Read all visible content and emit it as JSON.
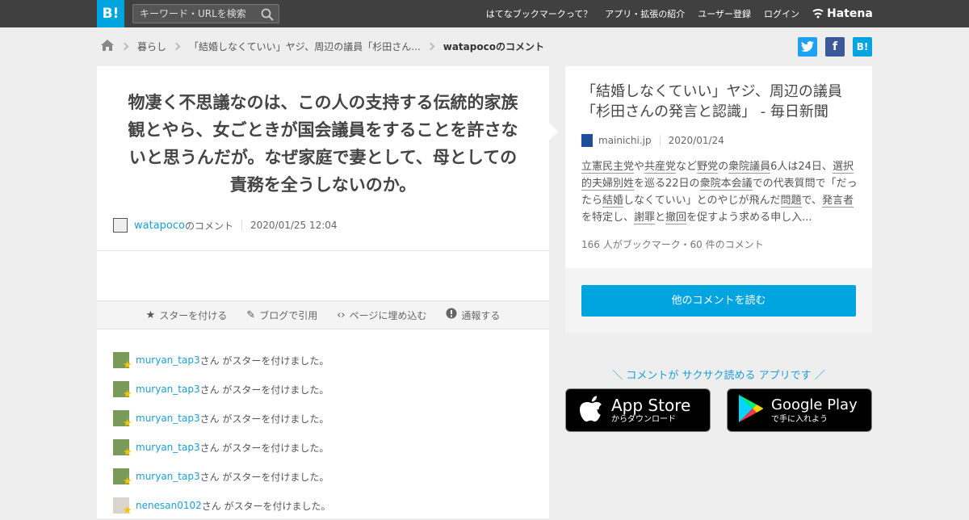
{
  "topbar": {
    "logo": "B!",
    "search_placeholder": "キーワード・URLを検索",
    "nav": [
      "はてなブックマークって？",
      "アプリ・拡張の紹介",
      "ユーザー登録",
      "ログイン"
    ],
    "hatena": "Hatena"
  },
  "breadcrumb": {
    "category": "暮らし",
    "article": "「結婚しなくていい」ヤジ、周辺の議員「杉田さん...",
    "current": "watapocoのコメント"
  },
  "share": {
    "twitter": "t",
    "facebook": "f",
    "hatebu": "B!"
  },
  "comment": {
    "text": "物凄く不思議なのは、この人の支持する伝統的家族観とやら、女ごときが国会議員をすることを許さないと思うんだが。なぜ家庭で妻として、母としての責務を全うしないのか。",
    "user": "watapoco",
    "suffix": "のコメント",
    "date": "2020/01/25 12:04"
  },
  "actions": {
    "star": "スターを付ける",
    "blog": "ブログで引用",
    "embed": "ページに埋め込む",
    "report": "通報する"
  },
  "stars": [
    {
      "user": "muryan_tap3",
      "text": "さん がスターを付けました。"
    },
    {
      "user": "muryan_tap3",
      "text": "さん がスターを付けました。"
    },
    {
      "user": "muryan_tap3",
      "text": "さん がスターを付けました。"
    },
    {
      "user": "muryan_tap3",
      "text": "さん がスターを付けました。"
    },
    {
      "user": "muryan_tap3",
      "text": "さん がスターを付けました。"
    },
    {
      "user": "nenesan0102",
      "text": "さん がスターを付けました。"
    }
  ],
  "entry": {
    "title": "「結婚しなくていい」ヤジ、周辺の議員「杉田さんの発言と認識」 - 毎日新聞",
    "domain": "mainichi.jp",
    "date": "2020/01/24",
    "desc": [
      {
        "t": "立憲民主党",
        "u": true
      },
      {
        "t": "や",
        "u": false
      },
      {
        "t": "共産党",
        "u": true
      },
      {
        "t": "など",
        "u": false
      },
      {
        "t": "野党",
        "u": true
      },
      {
        "t": "の",
        "u": false
      },
      {
        "t": "衆院議員",
        "u": true
      },
      {
        "t": "6人は24日、",
        "u": false
      },
      {
        "t": "選択的夫婦別姓",
        "u": true
      },
      {
        "t": "を巡る22日の",
        "u": false
      },
      {
        "t": "衆院本会議",
        "u": true
      },
      {
        "t": "での代表質問で「だったら",
        "u": false
      },
      {
        "t": "結婚",
        "u": true
      },
      {
        "t": "しなくていい」とのやじが飛んだ",
        "u": false
      },
      {
        "t": "問題",
        "u": true
      },
      {
        "t": "で、",
        "u": false
      },
      {
        "t": "発言者",
        "u": true
      },
      {
        "t": "を特定し、",
        "u": false
      },
      {
        "t": "謝罪",
        "u": true
      },
      {
        "t": "と",
        "u": false
      },
      {
        "t": "撤回",
        "u": true
      },
      {
        "t": "を促すよう求める申し入...",
        "u": false
      }
    ],
    "count": "166 人がブックマーク・60 件のコメント",
    "button": "他のコメントを読む"
  },
  "promo": {
    "tagline": "＼ コメントが サクサク読める アプリです ／",
    "appstore_big": "App Store",
    "appstore_small": "からダウンロード",
    "gplay_big": "Google Play",
    "gplay_small": "で手に入れよう"
  },
  "colors": {
    "brand": "#00a4de",
    "topbar": "#404040",
    "link": "#1a9ed9"
  }
}
